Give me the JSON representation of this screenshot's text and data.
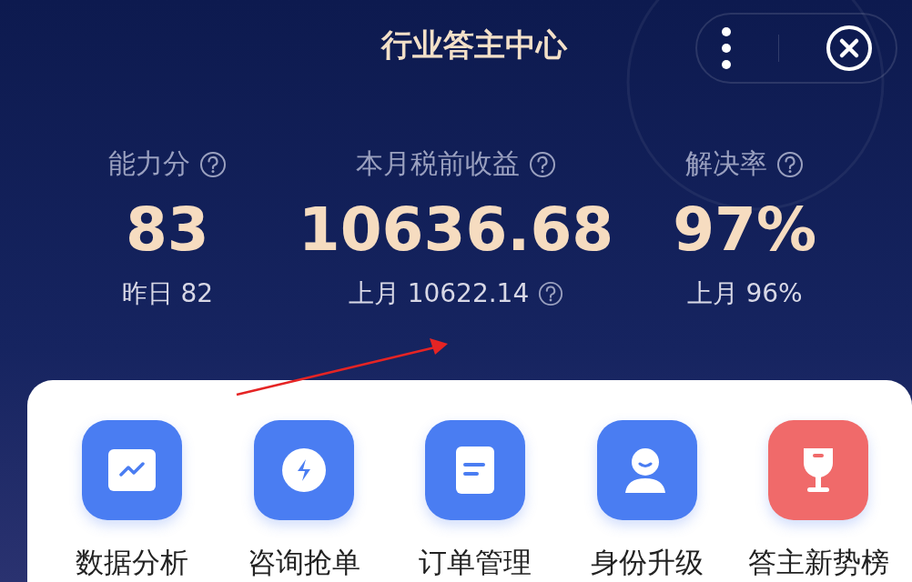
{
  "header": {
    "title": "行业答主中心"
  },
  "stats": [
    {
      "label": "能力分",
      "value": "83",
      "previous": "昨日 82",
      "previous_help": false
    },
    {
      "label": "本月税前收益",
      "value": "10636.68",
      "previous": "上月 10622.14",
      "previous_help": true
    },
    {
      "label": "解决率",
      "value": "97%",
      "previous": "上月 96%",
      "previous_help": false
    }
  ],
  "shortcuts": [
    {
      "label": "数据分析",
      "kind": "chart",
      "color": "#4a7df2"
    },
    {
      "label": "咨询抢单",
      "kind": "bolt",
      "color": "#4a7df2"
    },
    {
      "label": "订单管理",
      "kind": "document",
      "color": "#4a7df2"
    },
    {
      "label": "身份升级",
      "kind": "person",
      "color": "#4a7df2"
    },
    {
      "label": "答主新势榜",
      "kind": "trophy",
      "color": "#f06a6a"
    }
  ]
}
